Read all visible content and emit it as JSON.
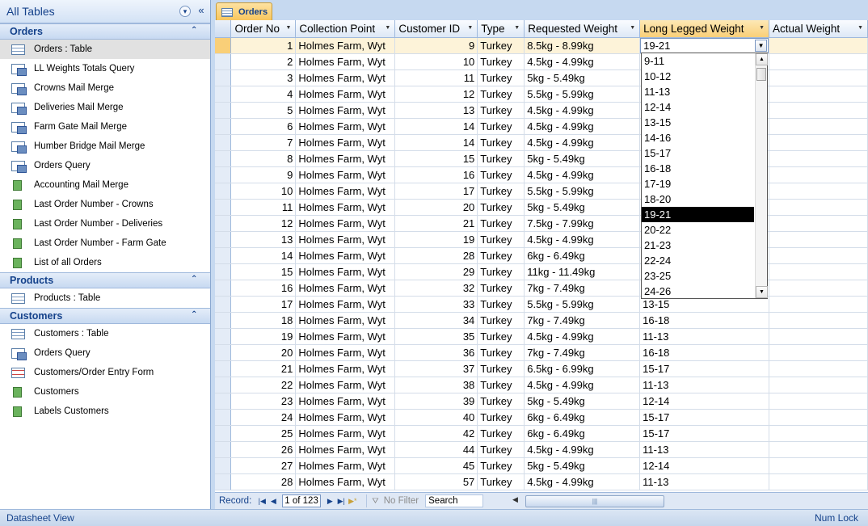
{
  "nav": {
    "title": "All Tables",
    "groups": [
      {
        "name": "Orders",
        "items": [
          {
            "label": "Orders : Table",
            "icon": "table-icon"
          },
          {
            "label": "LL Weights Totals Query",
            "icon": "query-icon"
          },
          {
            "label": "Crowns Mail Merge",
            "icon": "query-icon"
          },
          {
            "label": "Deliveries Mail Merge",
            "icon": "query-icon"
          },
          {
            "label": "Farm Gate Mail Merge",
            "icon": "query-icon"
          },
          {
            "label": "Humber Bridge Mail Merge",
            "icon": "query-icon"
          },
          {
            "label": "Orders Query",
            "icon": "query-icon"
          },
          {
            "label": "Accounting Mail Merge",
            "icon": "report-icon"
          },
          {
            "label": "Last Order Number - Crowns",
            "icon": "report-icon"
          },
          {
            "label": "Last Order Number - Deliveries",
            "icon": "report-icon"
          },
          {
            "label": "Last Order Number - Farm Gate",
            "icon": "report-icon"
          },
          {
            "label": "List of all Orders",
            "icon": "report-icon"
          }
        ]
      },
      {
        "name": "Products",
        "items": [
          {
            "label": "Products : Table",
            "icon": "table-icon"
          }
        ]
      },
      {
        "name": "Customers",
        "items": [
          {
            "label": "Customers : Table",
            "icon": "table-icon"
          },
          {
            "label": "Orders Query",
            "icon": "query-icon"
          },
          {
            "label": "Customers/Order Entry Form",
            "icon": "form-icon"
          },
          {
            "label": "Customers",
            "icon": "report-icon"
          },
          {
            "label": "Labels Customers",
            "icon": "report-icon"
          }
        ]
      }
    ]
  },
  "tab": {
    "label": "Orders"
  },
  "columns": [
    "Order No",
    "Collection Point",
    "Customer ID",
    "Type",
    "Requested Weight",
    "Long Legged Weight",
    "Actual Weight"
  ],
  "rows": [
    {
      "order": "1",
      "point": "Holmes Farm, Wyt",
      "cust": "9",
      "type": "Turkey",
      "req": "8.5kg - 8.99kg",
      "ll": "19-21",
      "act": ""
    },
    {
      "order": "2",
      "point": "Holmes Farm, Wyt",
      "cust": "10",
      "type": "Turkey",
      "req": "4.5kg - 4.99kg",
      "ll": "",
      "act": ""
    },
    {
      "order": "3",
      "point": "Holmes Farm, Wyt",
      "cust": "11",
      "type": "Turkey",
      "req": "5kg - 5.49kg",
      "ll": "",
      "act": ""
    },
    {
      "order": "4",
      "point": "Holmes Farm, Wyt",
      "cust": "12",
      "type": "Turkey",
      "req": "5.5kg - 5.99kg",
      "ll": "",
      "act": ""
    },
    {
      "order": "5",
      "point": "Holmes Farm, Wyt",
      "cust": "13",
      "type": "Turkey",
      "req": "4.5kg - 4.99kg",
      "ll": "",
      "act": ""
    },
    {
      "order": "6",
      "point": "Holmes Farm, Wyt",
      "cust": "14",
      "type": "Turkey",
      "req": "4.5kg - 4.99kg",
      "ll": "",
      "act": ""
    },
    {
      "order": "7",
      "point": "Holmes Farm, Wyt",
      "cust": "14",
      "type": "Turkey",
      "req": "4.5kg - 4.99kg",
      "ll": "",
      "act": ""
    },
    {
      "order": "8",
      "point": "Holmes Farm, Wyt",
      "cust": "15",
      "type": "Turkey",
      "req": "5kg - 5.49kg",
      "ll": "",
      "act": ""
    },
    {
      "order": "9",
      "point": "Holmes Farm, Wyt",
      "cust": "16",
      "type": "Turkey",
      "req": "4.5kg - 4.99kg",
      "ll": "",
      "act": ""
    },
    {
      "order": "10",
      "point": "Holmes Farm, Wyt",
      "cust": "17",
      "type": "Turkey",
      "req": "5.5kg - 5.99kg",
      "ll": "",
      "act": ""
    },
    {
      "order": "11",
      "point": "Holmes Farm, Wyt",
      "cust": "20",
      "type": "Turkey",
      "req": "5kg - 5.49kg",
      "ll": "",
      "act": ""
    },
    {
      "order": "12",
      "point": "Holmes Farm, Wyt",
      "cust": "21",
      "type": "Turkey",
      "req": "7.5kg - 7.99kg",
      "ll": "",
      "act": ""
    },
    {
      "order": "13",
      "point": "Holmes Farm, Wyt",
      "cust": "19",
      "type": "Turkey",
      "req": "4.5kg - 4.99kg",
      "ll": "",
      "act": ""
    },
    {
      "order": "14",
      "point": "Holmes Farm, Wyt",
      "cust": "28",
      "type": "Turkey",
      "req": "6kg - 6.49kg",
      "ll": "",
      "act": ""
    },
    {
      "order": "15",
      "point": "Holmes Farm, Wyt",
      "cust": "29",
      "type": "Turkey",
      "req": "11kg - 11.49kg",
      "ll": "",
      "act": ""
    },
    {
      "order": "16",
      "point": "Holmes Farm, Wyt",
      "cust": "32",
      "type": "Turkey",
      "req": "7kg - 7.49kg",
      "ll": "",
      "act": ""
    },
    {
      "order": "17",
      "point": "Holmes Farm, Wyt",
      "cust": "33",
      "type": "Turkey",
      "req": "5.5kg - 5.99kg",
      "ll": "13-15",
      "act": ""
    },
    {
      "order": "18",
      "point": "Holmes Farm, Wyt",
      "cust": "34",
      "type": "Turkey",
      "req": "7kg - 7.49kg",
      "ll": "16-18",
      "act": ""
    },
    {
      "order": "19",
      "point": "Holmes Farm, Wyt",
      "cust": "35",
      "type": "Turkey",
      "req": "4.5kg - 4.99kg",
      "ll": "11-13",
      "act": ""
    },
    {
      "order": "20",
      "point": "Holmes Farm, Wyt",
      "cust": "36",
      "type": "Turkey",
      "req": "7kg - 7.49kg",
      "ll": "16-18",
      "act": ""
    },
    {
      "order": "21",
      "point": "Holmes Farm, Wyt",
      "cust": "37",
      "type": "Turkey",
      "req": "6.5kg - 6.99kg",
      "ll": "15-17",
      "act": ""
    },
    {
      "order": "22",
      "point": "Holmes Farm, Wyt",
      "cust": "38",
      "type": "Turkey",
      "req": "4.5kg - 4.99kg",
      "ll": "11-13",
      "act": ""
    },
    {
      "order": "23",
      "point": "Holmes Farm, Wyt",
      "cust": "39",
      "type": "Turkey",
      "req": "5kg - 5.49kg",
      "ll": "12-14",
      "act": ""
    },
    {
      "order": "24",
      "point": "Holmes Farm, Wyt",
      "cust": "40",
      "type": "Turkey",
      "req": "6kg - 6.49kg",
      "ll": "15-17",
      "act": ""
    },
    {
      "order": "25",
      "point": "Holmes Farm, Wyt",
      "cust": "42",
      "type": "Turkey",
      "req": "6kg - 6.49kg",
      "ll": "15-17",
      "act": ""
    },
    {
      "order": "26",
      "point": "Holmes Farm, Wyt",
      "cust": "44",
      "type": "Turkey",
      "req": "4.5kg - 4.99kg",
      "ll": "11-13",
      "act": ""
    },
    {
      "order": "27",
      "point": "Holmes Farm, Wyt",
      "cust": "45",
      "type": "Turkey",
      "req": "5kg - 5.49kg",
      "ll": "12-14",
      "act": ""
    },
    {
      "order": "28",
      "point": "Holmes Farm, Wyt",
      "cust": "57",
      "type": "Turkey",
      "req": "4.5kg - 4.99kg",
      "ll": "11-13",
      "act": ""
    }
  ],
  "dropdown": {
    "options": [
      "9-11",
      "10-12",
      "11-13",
      "12-14",
      "13-15",
      "14-16",
      "15-17",
      "16-18",
      "17-19",
      "18-20",
      "19-21",
      "20-22",
      "21-23",
      "22-24",
      "23-25",
      "24-26"
    ],
    "selected": "19-21"
  },
  "record_nav": {
    "label": "Record:",
    "current": "1 of 123",
    "filter": "No Filter",
    "search": "Search"
  },
  "status": {
    "left": "Datasheet View",
    "right": "Num Lock"
  },
  "colors": {
    "accent": "#15428b",
    "tab_active": "#f8c55b",
    "selection": "#000000"
  }
}
